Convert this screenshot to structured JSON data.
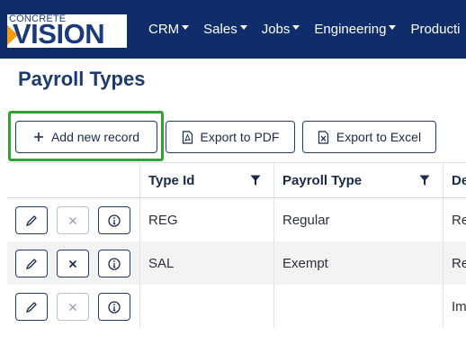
{
  "brand": {
    "logo_top": "CONCRETE",
    "logo_bottom": "VISION"
  },
  "nav": {
    "items": [
      {
        "label": "CRM",
        "caret": true
      },
      {
        "label": "Sales",
        "caret": true
      },
      {
        "label": "Jobs",
        "caret": true
      },
      {
        "label": "Engineering",
        "caret": true
      },
      {
        "label": "Producti",
        "caret": false
      }
    ]
  },
  "page": {
    "title": "Payroll Types"
  },
  "toolbar": {
    "add_label": "Add new record",
    "pdf_label": "Export to PDF",
    "excel_label": "Export to Excel"
  },
  "grid": {
    "columns": [
      "Type Id",
      "Payroll Type",
      "De"
    ],
    "rows": [
      {
        "type_id": "REG",
        "payroll_type": "Regular",
        "desc": "Re",
        "delete_enabled": false
      },
      {
        "type_id": "SAL",
        "payroll_type": "Exempt",
        "desc": "Re",
        "delete_enabled": true
      },
      {
        "type_id": "",
        "payroll_type": "",
        "desc": "Im",
        "delete_enabled": false
      }
    ]
  },
  "colors": {
    "topbar": "#0f2d6b",
    "title": "#1b3a6f",
    "highlight": "#2ea52e",
    "logo_accent": "#f39c12"
  }
}
